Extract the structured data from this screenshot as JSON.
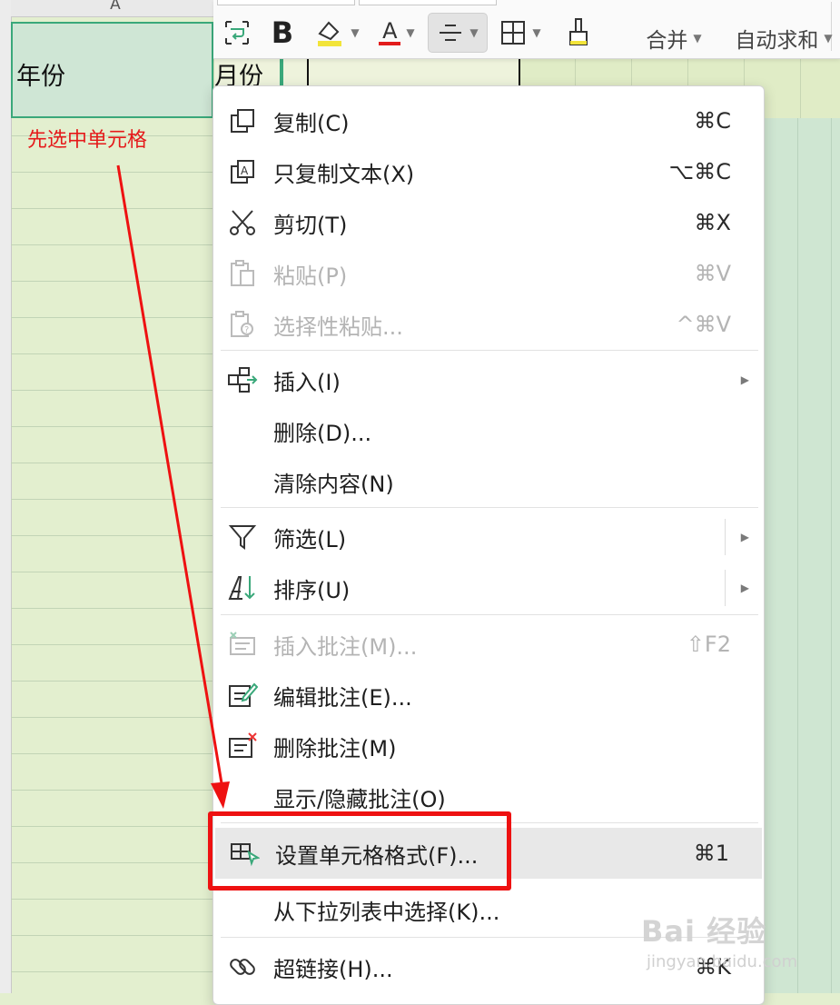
{
  "sheet": {
    "column_header_a": "A",
    "cell_a1": "年份",
    "cell_b1": "月份",
    "annotation": "先选中单元格",
    "annotation_color": "#e5191a",
    "selection_color": "#3aa87a"
  },
  "toolbar": {
    "merge_label": "合并",
    "autosum_label": "自动求和",
    "bold_label": "B",
    "font_color_label": "A"
  },
  "menu": {
    "items": [
      {
        "label": "复制(C)",
        "shortcut": "⌘C",
        "icon": "copy-icon",
        "enabled": true
      },
      {
        "label": "只复制文本(X)",
        "shortcut": "⌥⌘C",
        "icon": "copy-text-icon",
        "enabled": true
      },
      {
        "label": "剪切(T)",
        "shortcut": "⌘X",
        "icon": "scissors-icon",
        "enabled": true
      },
      {
        "label": "粘贴(P)",
        "shortcut": "⌘V",
        "icon": "paste-icon",
        "enabled": false
      },
      {
        "label": "选择性粘贴...",
        "shortcut": "^⌘V",
        "icon": "paste-special-icon",
        "enabled": false
      },
      {
        "label": "插入(I)",
        "shortcut": "",
        "icon": "insert-icon",
        "enabled": true,
        "submenu": true
      },
      {
        "label": "删除(D)...",
        "shortcut": "",
        "icon": "",
        "enabled": true
      },
      {
        "label": "清除内容(N)",
        "shortcut": "",
        "icon": "",
        "enabled": true
      },
      {
        "label": "筛选(L)",
        "shortcut": "",
        "icon": "filter-icon",
        "enabled": true,
        "submenu": true
      },
      {
        "label": "排序(U)",
        "shortcut": "",
        "icon": "sort-icon",
        "enabled": true,
        "submenu": true
      },
      {
        "label": "插入批注(M)...",
        "shortcut": "⇧F2",
        "icon": "insert-comment-icon",
        "enabled": false
      },
      {
        "label": "编辑批注(E)...",
        "shortcut": "",
        "icon": "edit-comment-icon",
        "enabled": true
      },
      {
        "label": "删除批注(M)",
        "shortcut": "",
        "icon": "delete-comment-icon",
        "enabled": true
      },
      {
        "label": "显示/隐藏批注(O)",
        "shortcut": "",
        "icon": "",
        "enabled": true
      },
      {
        "label": "设置单元格格式(F)...",
        "shortcut": "⌘1",
        "icon": "format-cells-icon",
        "enabled": true,
        "highlighted": true
      },
      {
        "label": "从下拉列表中选择(K)...",
        "shortcut": "",
        "icon": "",
        "enabled": true
      },
      {
        "label": "超链接(H)...",
        "shortcut": "⌘K",
        "icon": "link-icon",
        "enabled": true
      }
    ]
  },
  "watermark": {
    "brand": "Bai  经验",
    "url": "jingyan.baidu.com"
  },
  "highlight_color": "#ee1111"
}
